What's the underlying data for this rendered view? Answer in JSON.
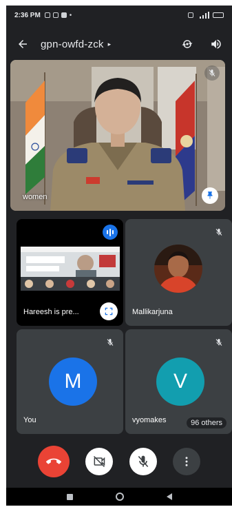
{
  "status_bar": {
    "time": "2:36 PM",
    "dot": "•"
  },
  "app_bar": {
    "meeting_code": "gpn-owfd-zck",
    "caret": "▸"
  },
  "main_tile": {
    "name": "women"
  },
  "tiles": {
    "share": {
      "label": "Hareesh is pre..."
    },
    "mallikarjuna": {
      "name": "Mallikarjuna"
    },
    "you": {
      "initial": "M",
      "name": "You",
      "avatar_color": "#1a73e8"
    },
    "vyomakes": {
      "initial": "V",
      "name": "vyomakes",
      "others": "96 others",
      "avatar_color": "#129eaf"
    }
  },
  "colors": {
    "background": "#202124",
    "tile": "#3c4043",
    "end_call": "#ea4335",
    "speaking": "#1a73e8"
  },
  "icons": [
    "back-arrow-icon",
    "switch-camera-icon",
    "speaker-icon",
    "mic-off-icon",
    "pin-icon",
    "audio-level-icon",
    "fullscreen-icon",
    "end-call-icon",
    "camera-off-icon",
    "more-vert-icon"
  ]
}
